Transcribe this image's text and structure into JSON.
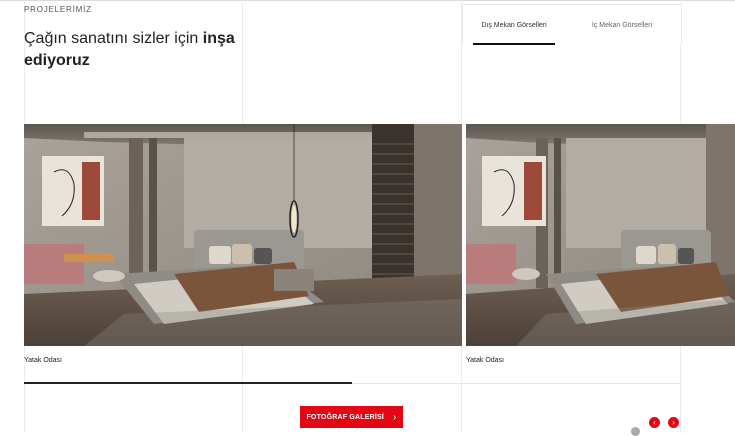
{
  "section": {
    "label": "PROJELERİMİZ"
  },
  "headline": {
    "normal": "Çağın sanatını sizler için ",
    "bold1": "inşa",
    "bold2": "ediyoruz"
  },
  "tabs": [
    {
      "label": "Dış Mekan Görselleri",
      "active": true
    },
    {
      "label": "İç Mekan Görselleri",
      "active": false
    }
  ],
  "slides": [
    {
      "caption": "Yatak Odası"
    },
    {
      "caption": "Yatak Odası"
    }
  ],
  "slider": {
    "progress_percent": 50,
    "prev_symbol": "‹",
    "next_symbol": "›"
  },
  "gallery_button": {
    "label": "FOTOĞRAF GALERİSİ",
    "chevron": "›"
  },
  "colors": {
    "accent": "#e30613",
    "text": "#222222"
  }
}
